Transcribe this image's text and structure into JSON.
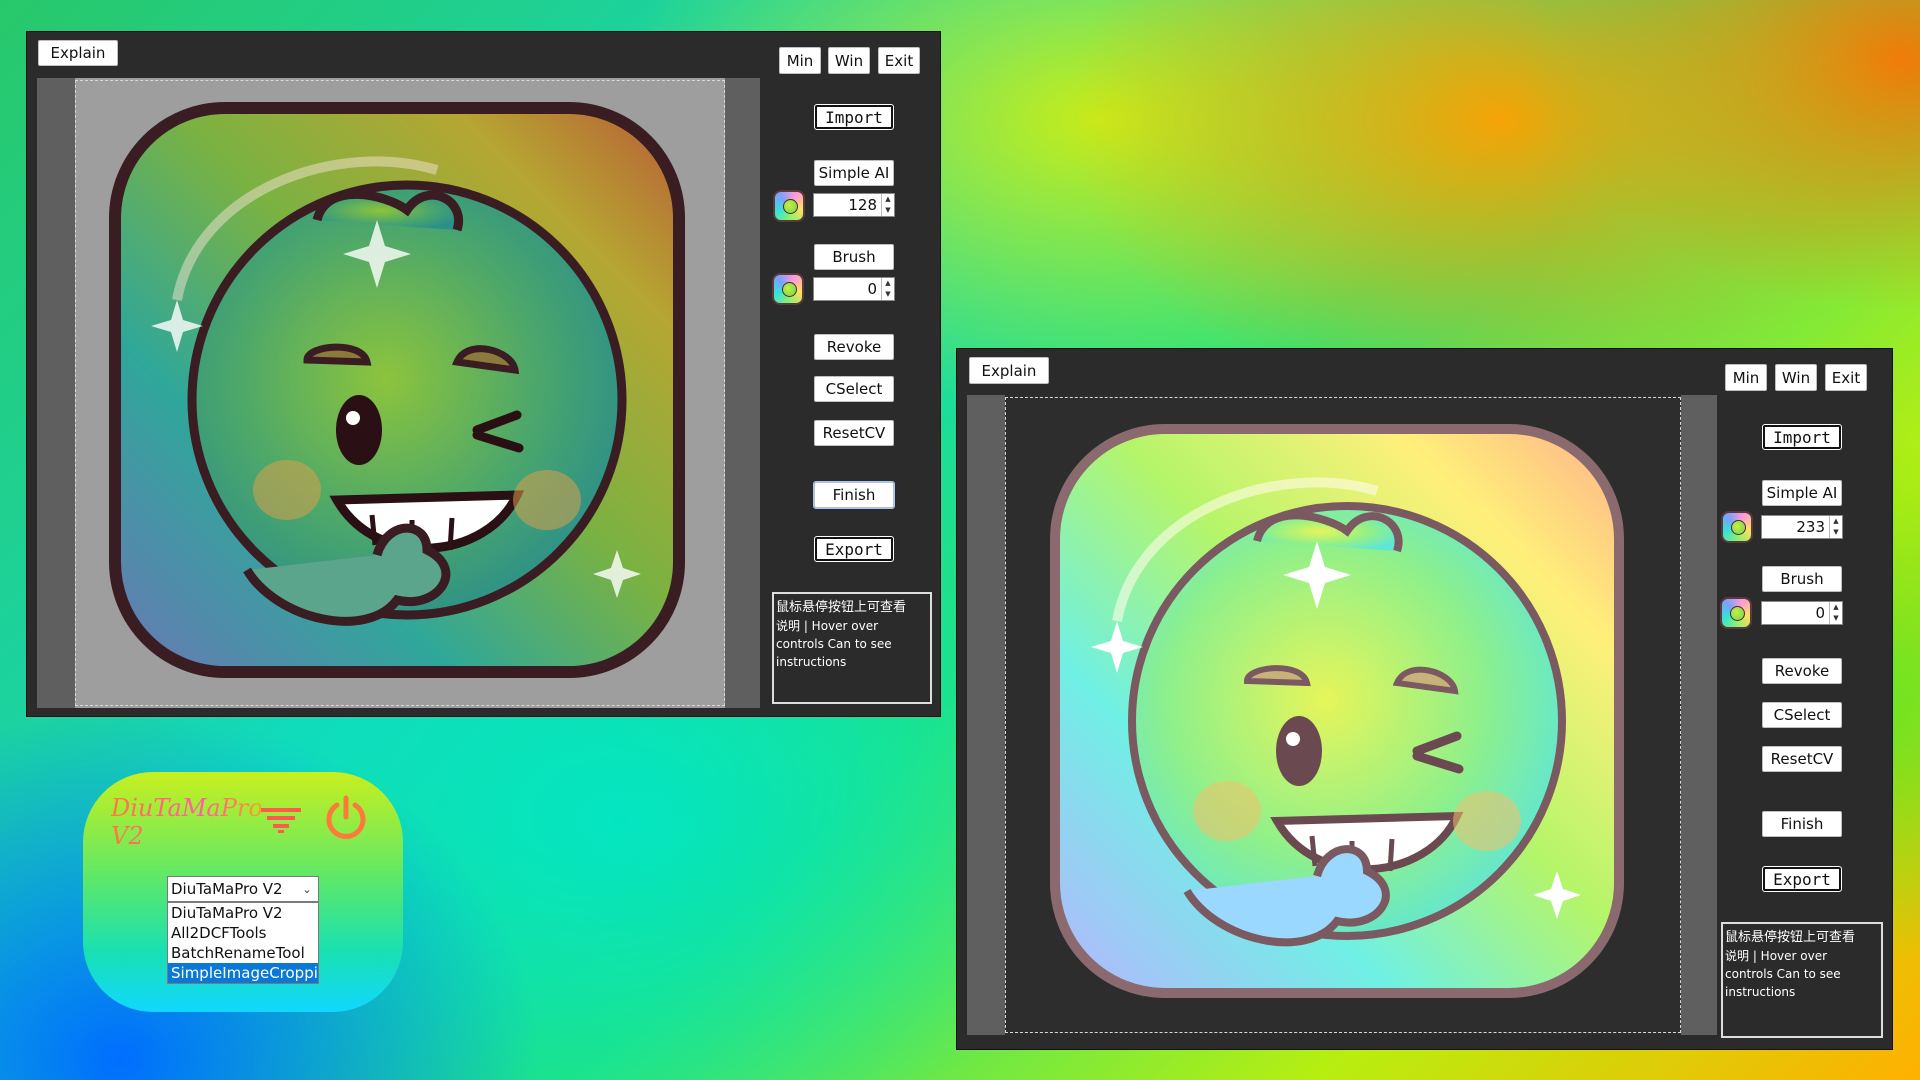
{
  "left_window": {
    "explain_label": "Explain",
    "controls": {
      "min": "Min",
      "win": "Win",
      "exit": "Exit"
    },
    "sidebar": {
      "import": "Import",
      "simple_ai": "Simple AI",
      "simple_ai_value": "128",
      "brush": "Brush",
      "brush_value": "0",
      "revoke": "Revoke",
      "cselect": "CSelect",
      "resetcv": "ResetCV",
      "finish": "Finish",
      "export": "Export"
    },
    "info_line1": "鼠标悬停按钮上可查看",
    "info_line2": "说明 | Hover over controls Can to see instructions"
  },
  "right_window": {
    "explain_label": "Explain",
    "controls": {
      "min": "Min",
      "win": "Win",
      "exit": "Exit"
    },
    "sidebar": {
      "import": "Import",
      "simple_ai": "Simple AI",
      "simple_ai_value": "233",
      "brush": "Brush",
      "brush_value": "0",
      "revoke": "Revoke",
      "cselect": "CSelect",
      "resetcv": "ResetCV",
      "finish": "Finish",
      "export": "Export"
    },
    "info_line1": "鼠标悬停按钮上可查看",
    "info_line2": "说明 | Hover over controls Can to see instructions"
  },
  "launcher": {
    "brand_line1": "DiuTaMaPro",
    "brand_line2": "V2",
    "selected": "DiuTaMaPro V2",
    "options": [
      "DiuTaMaPro V2",
      "All2DCFTools",
      "BatchRenameTool",
      "SimpleImageCroppi"
    ],
    "highlighted_index": 3,
    "colors": {
      "power": "#ff7a3a",
      "filter": "#ff5a50"
    }
  }
}
